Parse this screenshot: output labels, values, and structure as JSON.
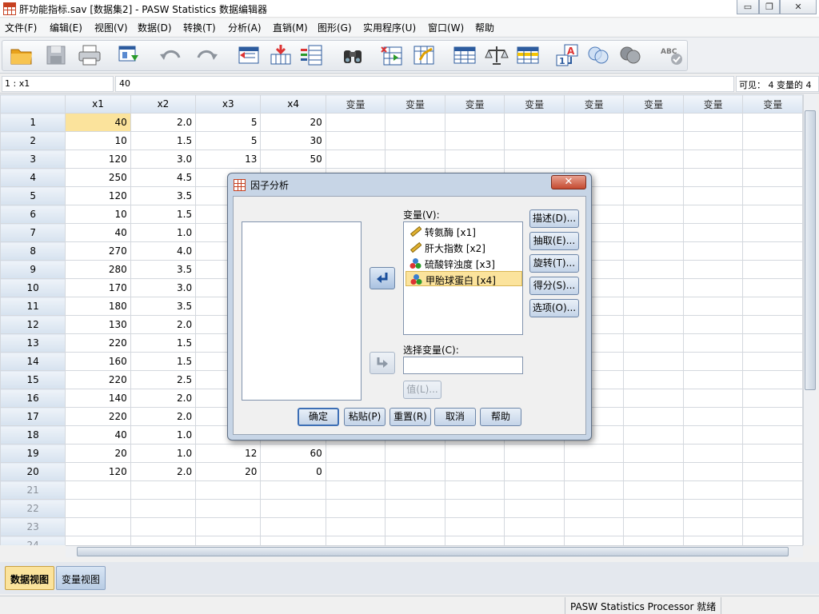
{
  "window": {
    "title": "肝功能指标.sav [数据集2] - PASW Statistics 数据编辑器",
    "minimize_glyph": "▭",
    "restore_glyph": "❐",
    "close_glyph": "✕"
  },
  "menu": [
    "文件(F)",
    "编辑(E)",
    "视图(V)",
    "数据(D)",
    "转换(T)",
    "分析(A)",
    "直销(M)",
    "图形(G)",
    "实用程序(U)",
    "窗口(W)",
    "帮助"
  ],
  "cellbar": {
    "ref": "1 : x1",
    "value": "40",
    "visible": "可见：  4 变量的 4"
  },
  "grid": {
    "columns": [
      "x1",
      "x2",
      "x3",
      "x4",
      "变量",
      "变量",
      "变量",
      "变量",
      "变量",
      "变量",
      "变量",
      "变量"
    ],
    "rows": [
      {
        "n": "1",
        "x1": "40",
        "x2": "2.0",
        "x3": "5",
        "x4": "20"
      },
      {
        "n": "2",
        "x1": "10",
        "x2": "1.5",
        "x3": "5",
        "x4": "30"
      },
      {
        "n": "3",
        "x1": "120",
        "x2": "3.0",
        "x3": "13",
        "x4": "50"
      },
      {
        "n": "4",
        "x1": "250",
        "x2": "4.5",
        "x3": "",
        "x4": ""
      },
      {
        "n": "5",
        "x1": "120",
        "x2": "3.5",
        "x3": "",
        "x4": ""
      },
      {
        "n": "6",
        "x1": "10",
        "x2": "1.5",
        "x3": "",
        "x4": ""
      },
      {
        "n": "7",
        "x1": "40",
        "x2": "1.0",
        "x3": "",
        "x4": ""
      },
      {
        "n": "8",
        "x1": "270",
        "x2": "4.0",
        "x3": "",
        "x4": ""
      },
      {
        "n": "9",
        "x1": "280",
        "x2": "3.5",
        "x3": "",
        "x4": ""
      },
      {
        "n": "10",
        "x1": "170",
        "x2": "3.0",
        "x3": "",
        "x4": ""
      },
      {
        "n": "11",
        "x1": "180",
        "x2": "3.5",
        "x3": "",
        "x4": ""
      },
      {
        "n": "12",
        "x1": "130",
        "x2": "2.0",
        "x3": "",
        "x4": ""
      },
      {
        "n": "13",
        "x1": "220",
        "x2": "1.5",
        "x3": "",
        "x4": ""
      },
      {
        "n": "14",
        "x1": "160",
        "x2": "1.5",
        "x3": "",
        "x4": ""
      },
      {
        "n": "15",
        "x1": "220",
        "x2": "2.5",
        "x3": "",
        "x4": ""
      },
      {
        "n": "16",
        "x1": "140",
        "x2": "2.0",
        "x3": "",
        "x4": ""
      },
      {
        "n": "17",
        "x1": "220",
        "x2": "2.0",
        "x3": "",
        "x4": ""
      },
      {
        "n": "18",
        "x1": "40",
        "x2": "1.0",
        "x3": "",
        "x4": ""
      },
      {
        "n": "19",
        "x1": "20",
        "x2": "1.0",
        "x3": "12",
        "x4": "60"
      },
      {
        "n": "20",
        "x1": "120",
        "x2": "2.0",
        "x3": "20",
        "x4": "0"
      },
      {
        "n": "21",
        "x1": "",
        "x2": "",
        "x3": "",
        "x4": ""
      },
      {
        "n": "22",
        "x1": "",
        "x2": "",
        "x3": "",
        "x4": ""
      },
      {
        "n": "23",
        "x1": "",
        "x2": "",
        "x3": "",
        "x4": ""
      },
      {
        "n": "24",
        "x1": "",
        "x2": "",
        "x3": "",
        "x4": ""
      }
    ]
  },
  "dialog": {
    "title": "因子分析",
    "variables_label": "变量(V):",
    "variables": [
      {
        "label": "转氨酶 [x1]",
        "icon": "scale-ruler-icon"
      },
      {
        "label": "肝大指数 [x2]",
        "icon": "scale-ruler-icon"
      },
      {
        "label": "硫酸锌浊度 [x3]",
        "icon": "nominal-balls-icon"
      },
      {
        "label": "甲胎球蛋白 [x4]",
        "icon": "nominal-balls-icon",
        "selected": true
      }
    ],
    "selection_label": "选择变量(C):",
    "value_button": "值(L)...",
    "side_buttons": [
      "描述(D)...",
      "抽取(E)...",
      "旋转(T)...",
      "得分(S)...",
      "选项(O)..."
    ],
    "bottom_buttons": [
      "确定",
      "粘贴(P)",
      "重置(R)",
      "取消",
      "帮助"
    ]
  },
  "view_tabs": [
    "数据视图",
    "变量视图"
  ],
  "status": "PASW Statistics Processor 就绪",
  "colors": {
    "selected_cell": "#fbe39c",
    "header": "#d9e4f1",
    "dialog_frame": "#c7d5e6",
    "close_button": "#c44a30"
  }
}
